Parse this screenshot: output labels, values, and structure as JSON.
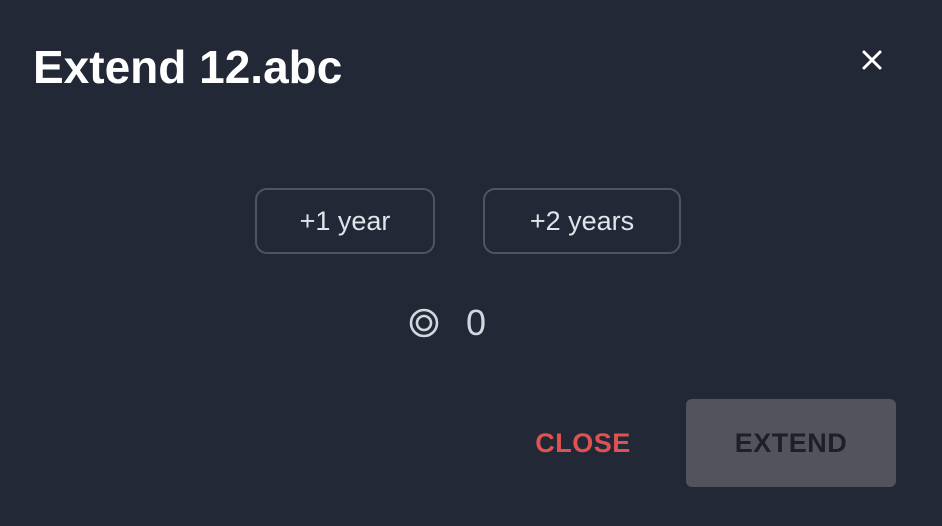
{
  "dialog": {
    "title": "Extend 12.abc",
    "close_icon": "close-x-icon"
  },
  "durations": [
    {
      "label": "+1 year"
    },
    {
      "label": "+2 years"
    }
  ],
  "cost": {
    "icon": "coin-icon",
    "value": "0"
  },
  "actions": {
    "close_label": "CLOSE",
    "extend_label": "EXTEND",
    "extend_disabled": true
  },
  "colors": {
    "background": "#222836",
    "title": "#ffffff",
    "close_text": "#e0524f",
    "extend_bg_disabled": "#52535c",
    "extend_text_disabled": "#1e2029",
    "outline_border": "#4f5462"
  }
}
